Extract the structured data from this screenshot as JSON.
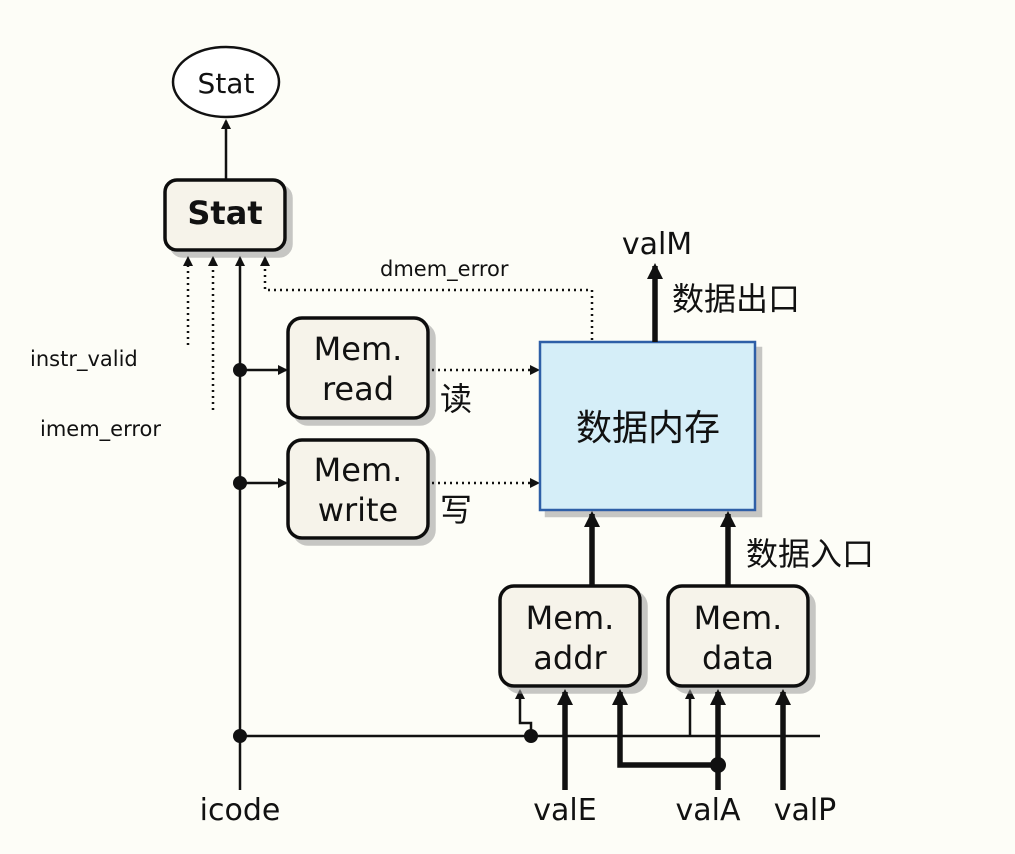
{
  "stat_oval": "Stat",
  "stat_block": "Stat",
  "signals": {
    "dmem_error": "dmem_error",
    "instr_valid": "instr_valid",
    "imem_error": "imem_error",
    "icode": "icode",
    "valE": "valE",
    "valA": "valA",
    "valP": "valP",
    "valM": "valM"
  },
  "blocks": {
    "mem_read": [
      "Mem.",
      "read"
    ],
    "mem_write": [
      "Mem.",
      "write"
    ],
    "mem_addr": [
      "Mem.",
      "addr"
    ],
    "mem_data": [
      "Mem.",
      "data"
    ],
    "data_memory": "数据内存"
  },
  "annotations": {
    "read": "读",
    "write": "写",
    "data_out": "数据出口",
    "data_in": "数据入口"
  },
  "colors": {
    "memory_fill": "#d5eef8",
    "memory_stroke": "#2f5fa7",
    "box_fill": "#f6f3ea",
    "line": "#111111"
  }
}
